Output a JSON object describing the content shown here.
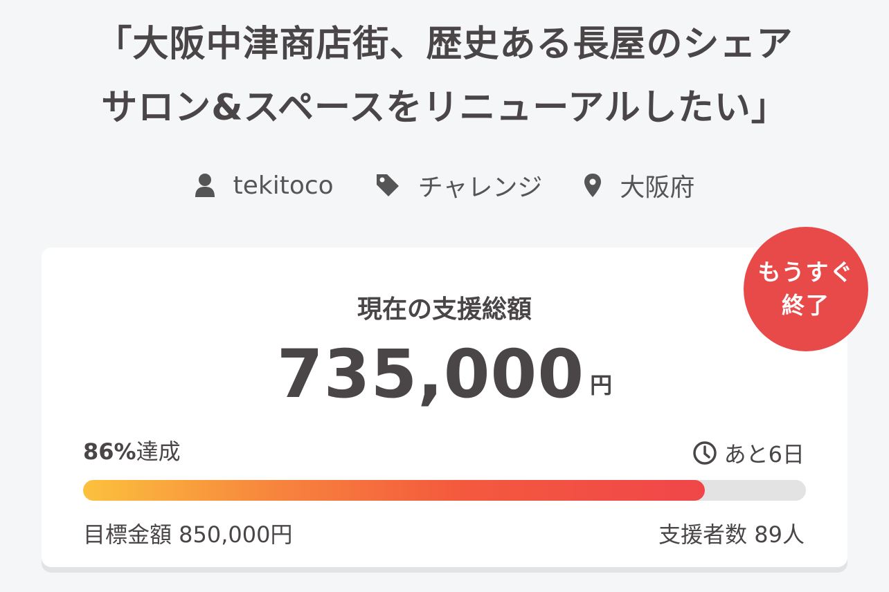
{
  "project": {
    "title_line1": "「大阪中津商店街、歴史ある長屋のシェア",
    "title_line2": "サロン&スペースをリニューアルしたい」"
  },
  "meta": {
    "owner": "tekitoco",
    "category": "チャレンジ",
    "location": "大阪府",
    "icons": [
      "user-icon",
      "tag-icon",
      "location-pin-icon"
    ]
  },
  "funding": {
    "label": "現在の支援総額",
    "amount": "735,000",
    "currency": "円",
    "achieved_percent": "86%",
    "achieved_suffix": "達成",
    "progress_fraction": 0.86,
    "remaining": "あと6日",
    "goal_label": "目標金額 850,000円",
    "supporters_label": "支援者数 89人"
  },
  "badge": {
    "line1": "もうすぐ",
    "line2": "終了"
  },
  "colors": {
    "background": "#f5f6f8",
    "card": "#ffffff",
    "badge": "#e84a4a",
    "text": "#4a4546",
    "progress_start": "#fcc13d",
    "progress_end": "#f0464a",
    "progress_track": "#e3e3e3"
  }
}
